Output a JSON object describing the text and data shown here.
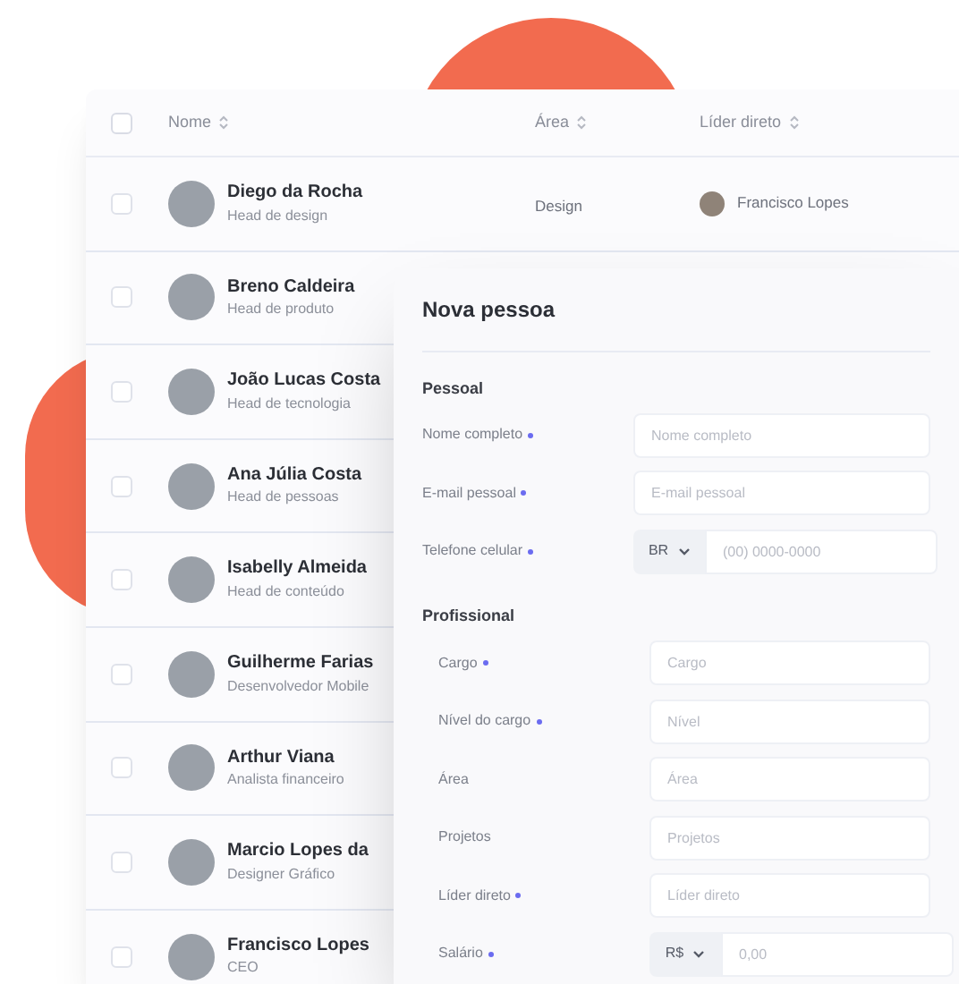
{
  "table": {
    "all_checked": false,
    "columns": [
      {
        "label": "Nome"
      },
      {
        "label": "Área"
      },
      {
        "label": "Líder direto"
      }
    ],
    "rows": [
      {
        "name": "Diego da Rocha",
        "role": "Head de design",
        "area": "Design",
        "leader": "Francisco Lopes",
        "checked": false
      },
      {
        "name": "Breno Caldeira",
        "role": "Head de produto",
        "checked": false
      },
      {
        "name": "João Lucas Costa",
        "role": "Head de tecnologia",
        "checked": false
      },
      {
        "name": "Ana Júlia Costa",
        "role": "Head de pessoas",
        "checked": false
      },
      {
        "name": "Isabelly Almeida",
        "role": "Head de conteúdo",
        "checked": false
      },
      {
        "name": "Guilherme Farias",
        "role": "Desenvolvedor Mobile",
        "checked": false
      },
      {
        "name": "Arthur Viana",
        "role": "Analista financeiro",
        "checked": false
      },
      {
        "name": "Marcio Lopes da",
        "role": "Designer Gráfico",
        "checked": false
      },
      {
        "name": "Francisco Lopes",
        "role": "CEO",
        "checked": false
      }
    ]
  },
  "modal": {
    "title": "Nova pessoa",
    "sections": [
      {
        "title": "Pessoal",
        "fields": [
          {
            "kind": "text",
            "label": "Nome completo",
            "required": true,
            "placeholder": "Nome completo"
          },
          {
            "kind": "text",
            "label": "E-mail pessoal",
            "required": true,
            "placeholder": "E-mail pessoal"
          },
          {
            "kind": "prefixed",
            "label": "Telefone celular",
            "required": true,
            "prefix": "BR",
            "placeholder": "(00) 0000-0000"
          }
        ]
      },
      {
        "title": "Profissional",
        "fields": [
          {
            "kind": "text",
            "label": "Cargo",
            "required": true,
            "placeholder": "Cargo"
          },
          {
            "kind": "text",
            "label": "Nível do cargo",
            "required": true,
            "placeholder": "Nível"
          },
          {
            "kind": "text",
            "label": "Área",
            "required": false,
            "placeholder": "Área"
          },
          {
            "kind": "text",
            "label": "Projetos",
            "required": false,
            "placeholder": "Projetos"
          },
          {
            "kind": "text",
            "label": "Líder direto",
            "required": true,
            "placeholder": "Líder direto"
          },
          {
            "kind": "prefixed",
            "label": "Salário",
            "required": true,
            "prefix": "R$",
            "placeholder": "0,00"
          }
        ]
      }
    ]
  }
}
